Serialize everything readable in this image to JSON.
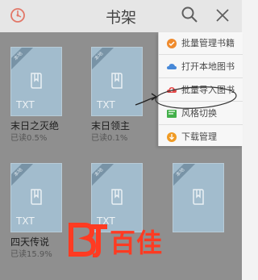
{
  "header": {
    "title": "书架",
    "back_icon": "round-clock-icon",
    "search_icon": "search-icon",
    "close_icon": "close-icon"
  },
  "books": [
    {
      "name": "末日之灭绝",
      "progress": "已读0.5%",
      "format": "TXT",
      "ribbon": "本地"
    },
    {
      "name": "末日领主",
      "progress": "已读0.1%",
      "format": "TXT",
      "ribbon": "本地"
    },
    {
      "name": "四天传说",
      "progress": "已读15.9%",
      "format": "TXT",
      "ribbon": "本地"
    },
    {
      "name": "",
      "progress": "",
      "format": "TXT",
      "ribbon": "本地"
    }
  ],
  "menu": [
    {
      "label": "批量管理书籍",
      "icon": "check-icon",
      "color": "#ef8b2d"
    },
    {
      "label": "打开本地图书",
      "icon": "cloud-icon",
      "color": "#4688d8"
    },
    {
      "label": "批量导入图书",
      "icon": "cloud-upload-icon",
      "color": "#e34a4a"
    },
    {
      "label": "风格切换",
      "icon": "theme-icon",
      "color": "#43b04a"
    },
    {
      "label": "下载管理",
      "icon": "download-icon",
      "color": "#f09b25"
    }
  ],
  "watermark": {
    "brand": "百佳",
    "color": "#ff3b22"
  }
}
